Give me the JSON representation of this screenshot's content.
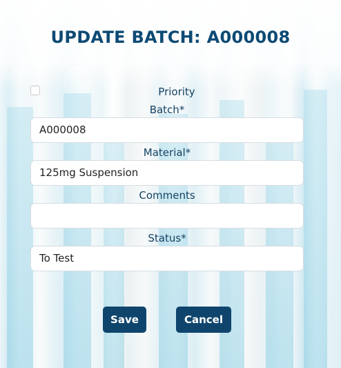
{
  "header": {
    "title": "UPDATE BATCH: A000008"
  },
  "form": {
    "priority": {
      "label": "Priority",
      "checked": false
    },
    "batch": {
      "label": "Batch*",
      "value": "A000008"
    },
    "material": {
      "label": "Material*",
      "value": "125mg Suspension"
    },
    "comments": {
      "label": "Comments",
      "value": ""
    },
    "status": {
      "label": "Status*",
      "value": "To Test"
    }
  },
  "actions": {
    "save_label": "Save",
    "cancel_label": "Cancel"
  },
  "colors": {
    "primary": "#0f456d",
    "title": "#0d4a74",
    "label": "#154262"
  }
}
